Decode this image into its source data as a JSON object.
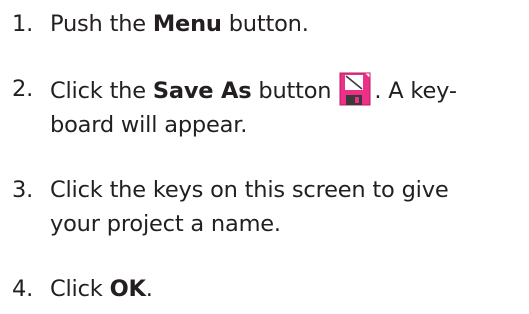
{
  "steps": [
    {
      "number": "1.",
      "text_before": "Push the ",
      "bold": "Menu",
      "text_after": " button."
    },
    {
      "number": "2.",
      "text_before": "Click the ",
      "bold": "Save As",
      "text_middle": " button",
      "icon": "save-as-floppy-icon",
      "text_after": ". A key-",
      "line2": "board will appear."
    },
    {
      "number": "3.",
      "line1": "Click the keys on this screen to give",
      "line2": "your project a name."
    },
    {
      "number": "4.",
      "text_before": "Click ",
      "bold": "OK",
      "text_after": "."
    }
  ],
  "colors": {
    "text": "#231f20",
    "icon_pink": "#ec2f87",
    "icon_dark": "#3a3a3a",
    "icon_label": "#ffffff"
  }
}
